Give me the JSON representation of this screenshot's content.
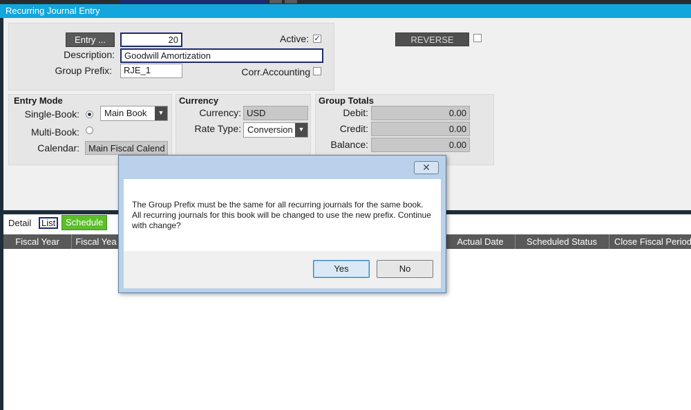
{
  "window": {
    "title": "Recurring Journal Entry"
  },
  "header": {
    "entry_button": "Entry ...",
    "entry_value": "20",
    "active_label": "Active:",
    "active_checked": true,
    "description_label": "Description:",
    "description_value": "Goodwill Amortization",
    "group_prefix_label": "Group Prefix:",
    "group_prefix_value": "RJE_1",
    "corr_accounting_label": "Corr.Accounting",
    "corr_accounting_checked": false,
    "reverse_button": "REVERSE",
    "reverse_checked": false
  },
  "entry_mode": {
    "heading": "Entry Mode",
    "single_book_label": "Single-Book:",
    "single_book_selected": true,
    "single_book_value": "Main Book",
    "multi_book_label": "Multi-Book:",
    "multi_book_selected": false,
    "calendar_label": "Calendar:",
    "calendar_value": "Main Fiscal Calend"
  },
  "currency": {
    "heading": "Currency",
    "currency_label": "Currency:",
    "currency_value": "USD",
    "rate_type_label": "Rate Type:",
    "rate_type_value": "Conversion"
  },
  "group_totals": {
    "heading": "Group Totals",
    "debit_label": "Debit:",
    "debit_value": "0.00",
    "credit_label": "Credit:",
    "credit_value": "0.00",
    "balance_label": "Balance:",
    "balance_value": "0.00"
  },
  "tabs": [
    {
      "label": "Detail",
      "state": "normal"
    },
    {
      "label": "List",
      "state": "focused"
    },
    {
      "label": "Schedule",
      "state": "active"
    }
  ],
  "grid": {
    "columns": [
      "Fiscal Year",
      "Fiscal Yea",
      "Actual Date",
      "Scheduled Status",
      "Close Fiscal Period"
    ]
  },
  "dialog": {
    "message": "The Group Prefix must be the same for all recurring journals for the same book.  All recurring journals for this book will be changed to use the new prefix.  Continue with change?",
    "yes_label": "Yes",
    "no_label": "No",
    "close_glyph": "✕"
  },
  "colors": {
    "titlebar": "#12a6dc",
    "schedule_tab": "#5cbf2a",
    "grid_header": "#595959",
    "dialog_frame": "#b9d1ea"
  }
}
